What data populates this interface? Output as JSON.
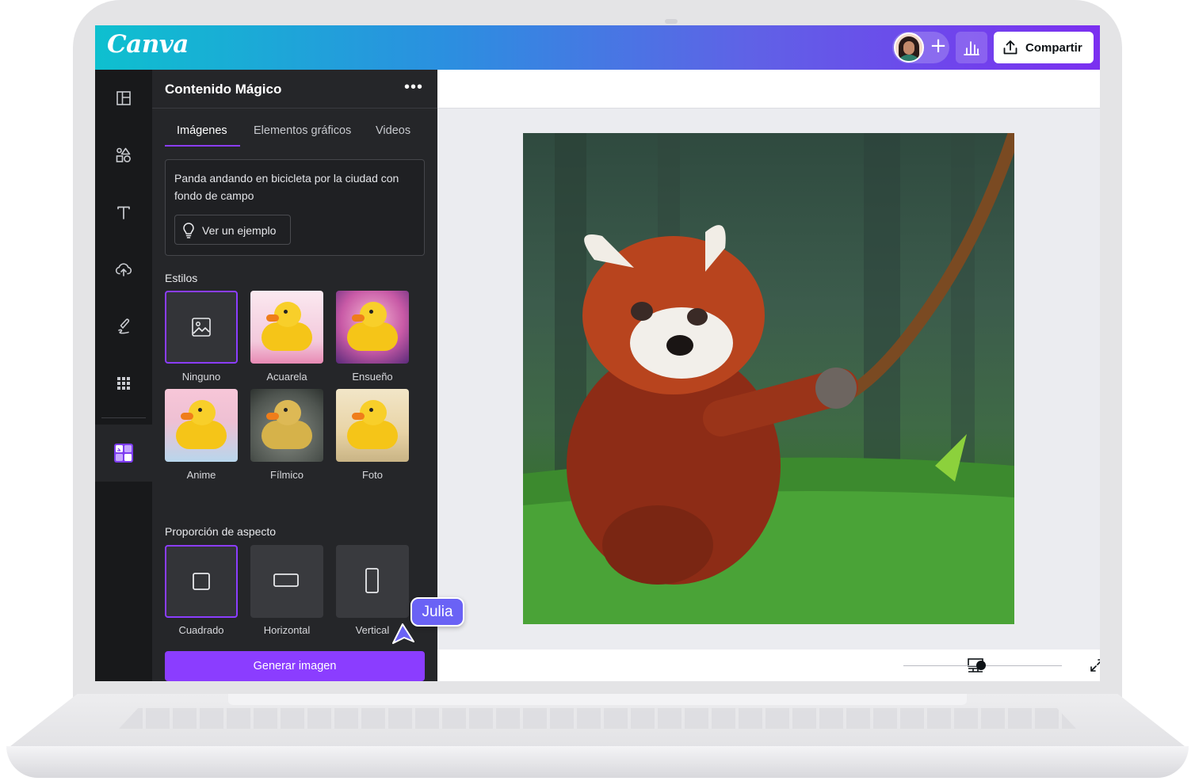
{
  "app": {
    "logo_text": "Canva"
  },
  "topbar": {
    "share_label": "Compartir",
    "colors": {
      "gradient_start": "#0ec0cf",
      "gradient_end": "#7b2ff0"
    }
  },
  "rail": {
    "items": [
      {
        "icon": "layout-icon"
      },
      {
        "icon": "elements-icon"
      },
      {
        "icon": "text-icon"
      },
      {
        "icon": "upload-icon"
      },
      {
        "icon": "draw-icon"
      },
      {
        "icon": "apps-grid-icon"
      },
      {
        "icon": "magic-media-icon",
        "active": true
      }
    ]
  },
  "panel": {
    "title": "Contenido Mágico",
    "tabs": [
      {
        "label": "Imágenes",
        "active": true
      },
      {
        "label": "Elementos gráficos"
      },
      {
        "label": "Videos"
      }
    ],
    "prompt_text": "Panda andando en bicicleta por la ciudad con fondo de campo",
    "example_button": "Ver un ejemplo",
    "styles_label": "Estilos",
    "styles": [
      {
        "label": "Ninguno",
        "selected": true
      },
      {
        "label": "Acuarela"
      },
      {
        "label": "Ensueño"
      },
      {
        "label": "Anime"
      },
      {
        "label": "Fílmico"
      },
      {
        "label": "Foto"
      }
    ],
    "aspect_label": "Proporción de aspecto",
    "aspects": [
      {
        "label": "Cuadrado",
        "selected": true
      },
      {
        "label": "Horizontal"
      },
      {
        "label": "Vertical"
      }
    ],
    "generate_button": "Generar imagen",
    "accent_color": "#8b3dff"
  },
  "canvas": {
    "zoom_fraction": 0.49
  },
  "collaborator": {
    "name": "Julia",
    "color": "#6a62f5"
  }
}
